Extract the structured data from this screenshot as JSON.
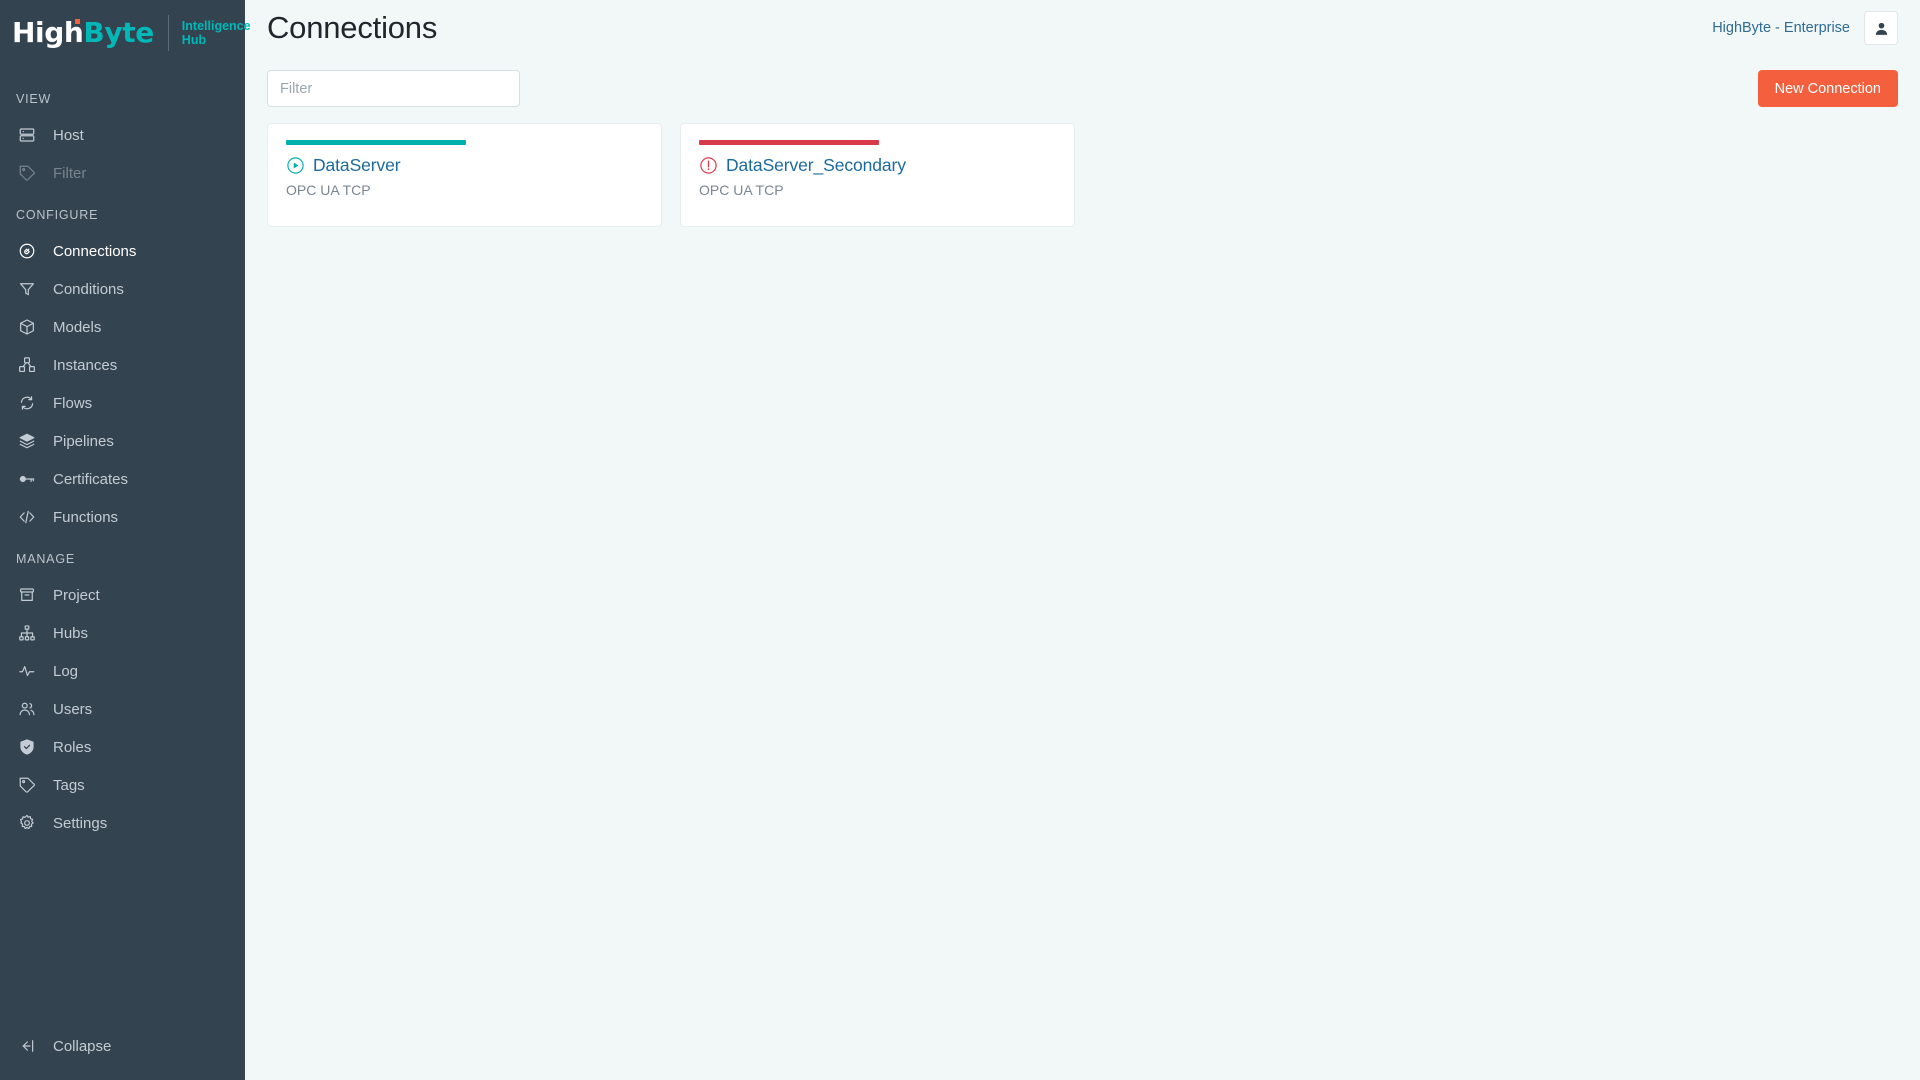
{
  "brand": {
    "name_part1": "High",
    "name_part2": "Byte",
    "product_line1": "Intelligence",
    "product_line2": "Hub",
    "accent_teal": "#00b8b8",
    "accent_orange": "#f4603e",
    "sidebar_bg": "#344350"
  },
  "sidebar": {
    "sections": [
      {
        "label": "VIEW",
        "items": [
          {
            "label": "Host",
            "icon": "server-icon",
            "state": "default"
          },
          {
            "label": "Filter",
            "icon": "tag-icon",
            "state": "disabled"
          }
        ]
      },
      {
        "label": "CONFIGURE",
        "items": [
          {
            "label": "Connections",
            "icon": "plug-circle-icon",
            "state": "active"
          },
          {
            "label": "Conditions",
            "icon": "funnel-icon",
            "state": "default"
          },
          {
            "label": "Models",
            "icon": "cube-icon",
            "state": "default"
          },
          {
            "label": "Instances",
            "icon": "cubes-icon",
            "state": "default"
          },
          {
            "label": "Flows",
            "icon": "refresh-circle-icon",
            "state": "default"
          },
          {
            "label": "Pipelines",
            "icon": "layers-icon",
            "state": "default"
          },
          {
            "label": "Certificates",
            "icon": "key-icon",
            "state": "default"
          },
          {
            "label": "Functions",
            "icon": "code-icon",
            "state": "default"
          }
        ]
      },
      {
        "label": "MANAGE",
        "items": [
          {
            "label": "Project",
            "icon": "archive-icon",
            "state": "default"
          },
          {
            "label": "Hubs",
            "icon": "sitemap-icon",
            "state": "default"
          },
          {
            "label": "Log",
            "icon": "activity-icon",
            "state": "default"
          },
          {
            "label": "Users",
            "icon": "users-icon",
            "state": "default"
          },
          {
            "label": "Roles",
            "icon": "shield-check-icon",
            "state": "default"
          },
          {
            "label": "Tags",
            "icon": "tag-icon",
            "state": "default"
          },
          {
            "label": "Settings",
            "icon": "gear-icon",
            "state": "default"
          }
        ]
      }
    ],
    "collapse": {
      "label": "Collapse",
      "icon": "collapse-left-icon"
    }
  },
  "header": {
    "title": "Connections",
    "tenant": "HighByte - Enterprise",
    "avatar_icon": "user-icon"
  },
  "toolbar": {
    "filter_placeholder": "Filter",
    "filter_value": "",
    "new_connection_label": "New Connection"
  },
  "connections": [
    {
      "name": "DataServer",
      "protocol": "OPC UA TCP",
      "status": "running",
      "status_icon": "play-circle-icon",
      "bar_color": "#00b0ac",
      "icon_color": "#00b0ac"
    },
    {
      "name": "DataServer_Secondary",
      "protocol": "OPC UA TCP",
      "status": "error",
      "status_icon": "alert-circle-icon",
      "bar_color": "#d93a4a",
      "icon_color": "#d93a4a"
    }
  ]
}
